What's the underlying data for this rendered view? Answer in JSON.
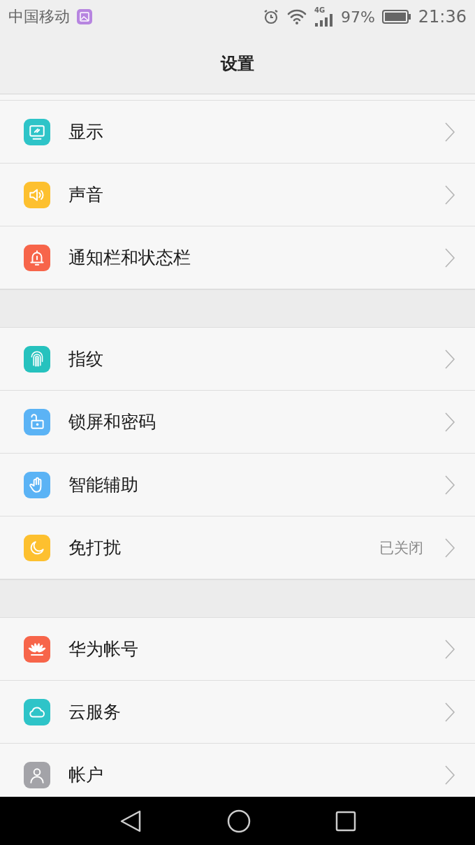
{
  "status_bar": {
    "carrier": "中国移动",
    "network": "4G",
    "battery": "97%",
    "time": "21:36"
  },
  "header": {
    "title": "设置"
  },
  "sections": [
    {
      "items": [
        {
          "label": "显示",
          "kind": "display",
          "color": "#2ec4c8"
        },
        {
          "label": "声音",
          "kind": "sound",
          "color": "#fdc02f"
        },
        {
          "label": "通知栏和状态栏",
          "kind": "bell",
          "color": "#f7654a"
        }
      ]
    },
    {
      "items": [
        {
          "label": "指纹",
          "kind": "fingerprint",
          "color": "#26c2be"
        },
        {
          "label": "锁屏和密码",
          "kind": "lock",
          "color": "#5bb3f5"
        },
        {
          "label": "智能辅助",
          "kind": "hand",
          "color": "#5bb3f5"
        },
        {
          "label": "免打扰",
          "kind": "moon",
          "color": "#fdc02f",
          "value": "已关闭"
        }
      ]
    },
    {
      "items": [
        {
          "label": "华为帐号",
          "kind": "huawei",
          "color": "#f7654a"
        },
        {
          "label": "云服务",
          "kind": "cloud",
          "color": "#2ec4c8"
        },
        {
          "label": "帐户",
          "kind": "person",
          "color": "#a3a3a8"
        }
      ]
    }
  ]
}
